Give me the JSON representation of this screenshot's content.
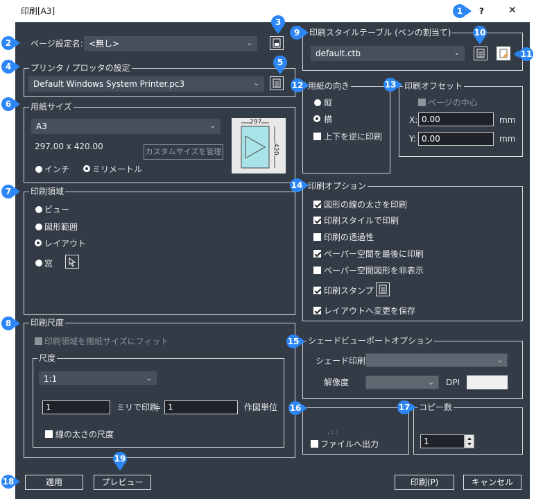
{
  "window": {
    "title": "印刷[A3]",
    "help": "?",
    "close": "✕"
  },
  "page_setup": {
    "label": "ページ設定名:",
    "value": "<無し>"
  },
  "printer": {
    "legend": "プリンタ / プロッタの設定",
    "value": "Default Windows System Printer.pc3"
  },
  "paper_size": {
    "legend": "用紙サイズ",
    "value": "A3",
    "dimensions": "297.00 x 420.00",
    "custom_button": "カスタムサイズを管理",
    "inch": "インチ",
    "mm": "ミリメートル",
    "preview_width": "297",
    "preview_height": "420"
  },
  "print_area": {
    "legend": "印刷領域",
    "view": "ビュー",
    "extents": "図形範囲",
    "layout": "レイアウト",
    "window": "窓"
  },
  "print_scale": {
    "legend": "印刷尺度",
    "fit": "印刷領域を用紙サイズにフィット",
    "scale_legend": "尺度",
    "scale_value": "1:1",
    "mm_value": "1",
    "mm_label": "ミリで印刷",
    "equals": "=",
    "unit_value": "1",
    "unit_label": "作図単位",
    "lineweight": "線の太さの尺度"
  },
  "style_table": {
    "legend": "印刷スタイルテーブル (ペンの割当て)",
    "value": "default.ctb"
  },
  "orientation": {
    "legend": "用紙の向き",
    "portrait": "縦",
    "landscape": "横",
    "upside_down": "上下を逆に印刷"
  },
  "offset": {
    "legend": "印刷オフセット",
    "center": "ページの中心",
    "x_label": "X:",
    "x_value": "0.00",
    "y_label": "Y:",
    "y_value": "0.00",
    "unit": "mm"
  },
  "options": {
    "legend": "印刷オプション",
    "items": [
      {
        "label": "図形の線の太さを印刷",
        "checked": true
      },
      {
        "label": "印刷スタイルで印刷",
        "checked": true
      },
      {
        "label": "印刷の透過性",
        "checked": false
      },
      {
        "label": "ペーパー空間を最後に印刷",
        "checked": true
      },
      {
        "label": "ペーパー空間図形を非表示",
        "checked": false
      },
      {
        "label": "印刷スタンプ",
        "checked": true
      },
      {
        "label": "レイアウトへ変更を保存",
        "checked": true
      }
    ]
  },
  "shaded": {
    "legend": "シェードビューポートオプション",
    "shade_label": "シェード印刷",
    "quality_label": "解像度",
    "dpi_label": "DPI"
  },
  "output": {
    "dots": ". : :",
    "to_file": "ファイルへ出力"
  },
  "copies": {
    "legend": "コピー数",
    "value": "1"
  },
  "footer": {
    "apply": "適用",
    "preview": "プレビュー",
    "print": "印刷(P)",
    "cancel": "キャンセル"
  },
  "badges": [
    "1",
    "2",
    "3",
    "4",
    "5",
    "6",
    "7",
    "8",
    "9",
    "10",
    "11",
    "12",
    "13",
    "14",
    "15",
    "16",
    "17",
    "18",
    "19"
  ],
  "colors": {
    "dialog_bg": "#333b46",
    "badge": "#2d86f5",
    "field_bg": "#46505c"
  }
}
